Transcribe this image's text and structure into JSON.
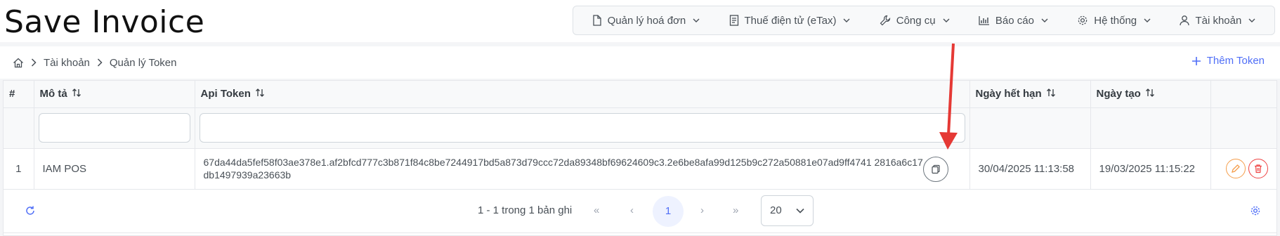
{
  "app": {
    "brand": "Save Invoice"
  },
  "menu": [
    {
      "label": "Quản lý hoá đơn",
      "icon": "document-icon"
    },
    {
      "label": "Thuế điện tử (eTax)",
      "icon": "book-icon"
    },
    {
      "label": "Công cụ",
      "icon": "wrench-icon"
    },
    {
      "label": "Báo cáo",
      "icon": "chart-icon"
    },
    {
      "label": "Hệ thống",
      "icon": "gear-icon"
    },
    {
      "label": "Tài khoản",
      "icon": "user-icon"
    }
  ],
  "breadcrumb": {
    "home_icon": "home-icon",
    "items": [
      "Tài khoản",
      "Quản lý Token"
    ]
  },
  "actions": {
    "add_token_label": "Thêm Token"
  },
  "table": {
    "columns": [
      "#",
      "Mô tả",
      "Api Token",
      "Ngày hết hạn",
      "Ngày tạo"
    ],
    "rows": [
      {
        "index": "1",
        "description": "IAM POS",
        "token": "67da44da5fef58f03ae378e1.af2bfcd777c3b871f84c8be7244917bd5a873d79ccc72da89348bf69624609c3.2e6be8afa99d125b9c272a50881e07ad9ff4741 2816a6c17db1497939a23663b",
        "expires": "30/04/2025 11:13:58",
        "created": "19/03/2025 11:15:22"
      }
    ]
  },
  "paginator": {
    "report": "1 - 1 trong 1 bản ghi",
    "first": "«",
    "prev": "‹",
    "current_page": "1",
    "next": "›",
    "last": "»",
    "rows_per_page": "20"
  },
  "annotation": {
    "arrow_color": "#e53935"
  }
}
